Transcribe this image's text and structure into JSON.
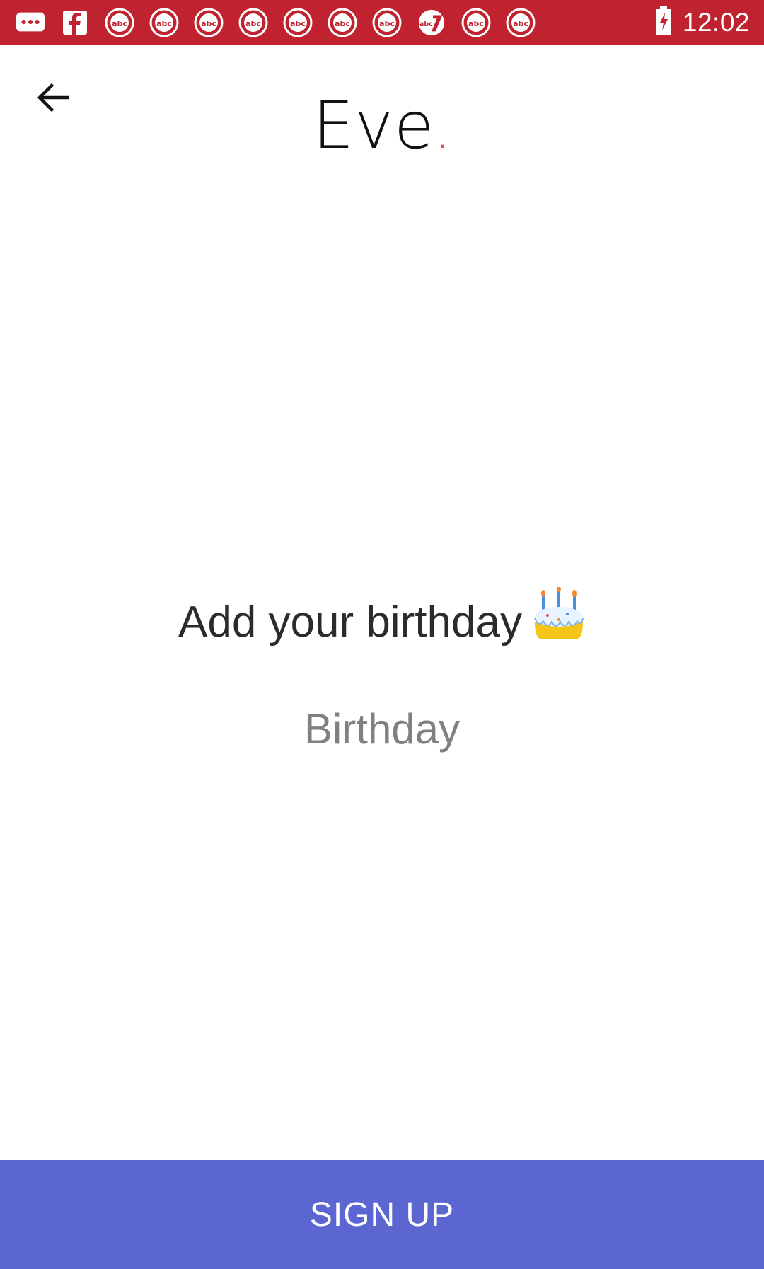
{
  "status_bar": {
    "time": "12:02",
    "notification_icons": [
      "messages-icon",
      "facebook-icon",
      "abc-news-icon",
      "abc-news-icon",
      "abc-news-icon",
      "abc-news-icon",
      "abc-news-icon",
      "abc-news-icon",
      "abc-news-icon",
      "abc7-icon",
      "abc-news-icon",
      "abc-news-icon"
    ],
    "battery_icon": "battery-icon",
    "background_color": "#c1222f"
  },
  "app": {
    "logo_text": "Eve",
    "logo_dot": ".",
    "accent_color": "#e5484d"
  },
  "main": {
    "heading": "Add your birthday",
    "heading_emoji": "birthday-cake-icon",
    "birthday_field": {
      "placeholder": "Birthday",
      "value": ""
    }
  },
  "footer": {
    "signup_label": "SIGN UP",
    "signup_color": "#5c66d1"
  }
}
